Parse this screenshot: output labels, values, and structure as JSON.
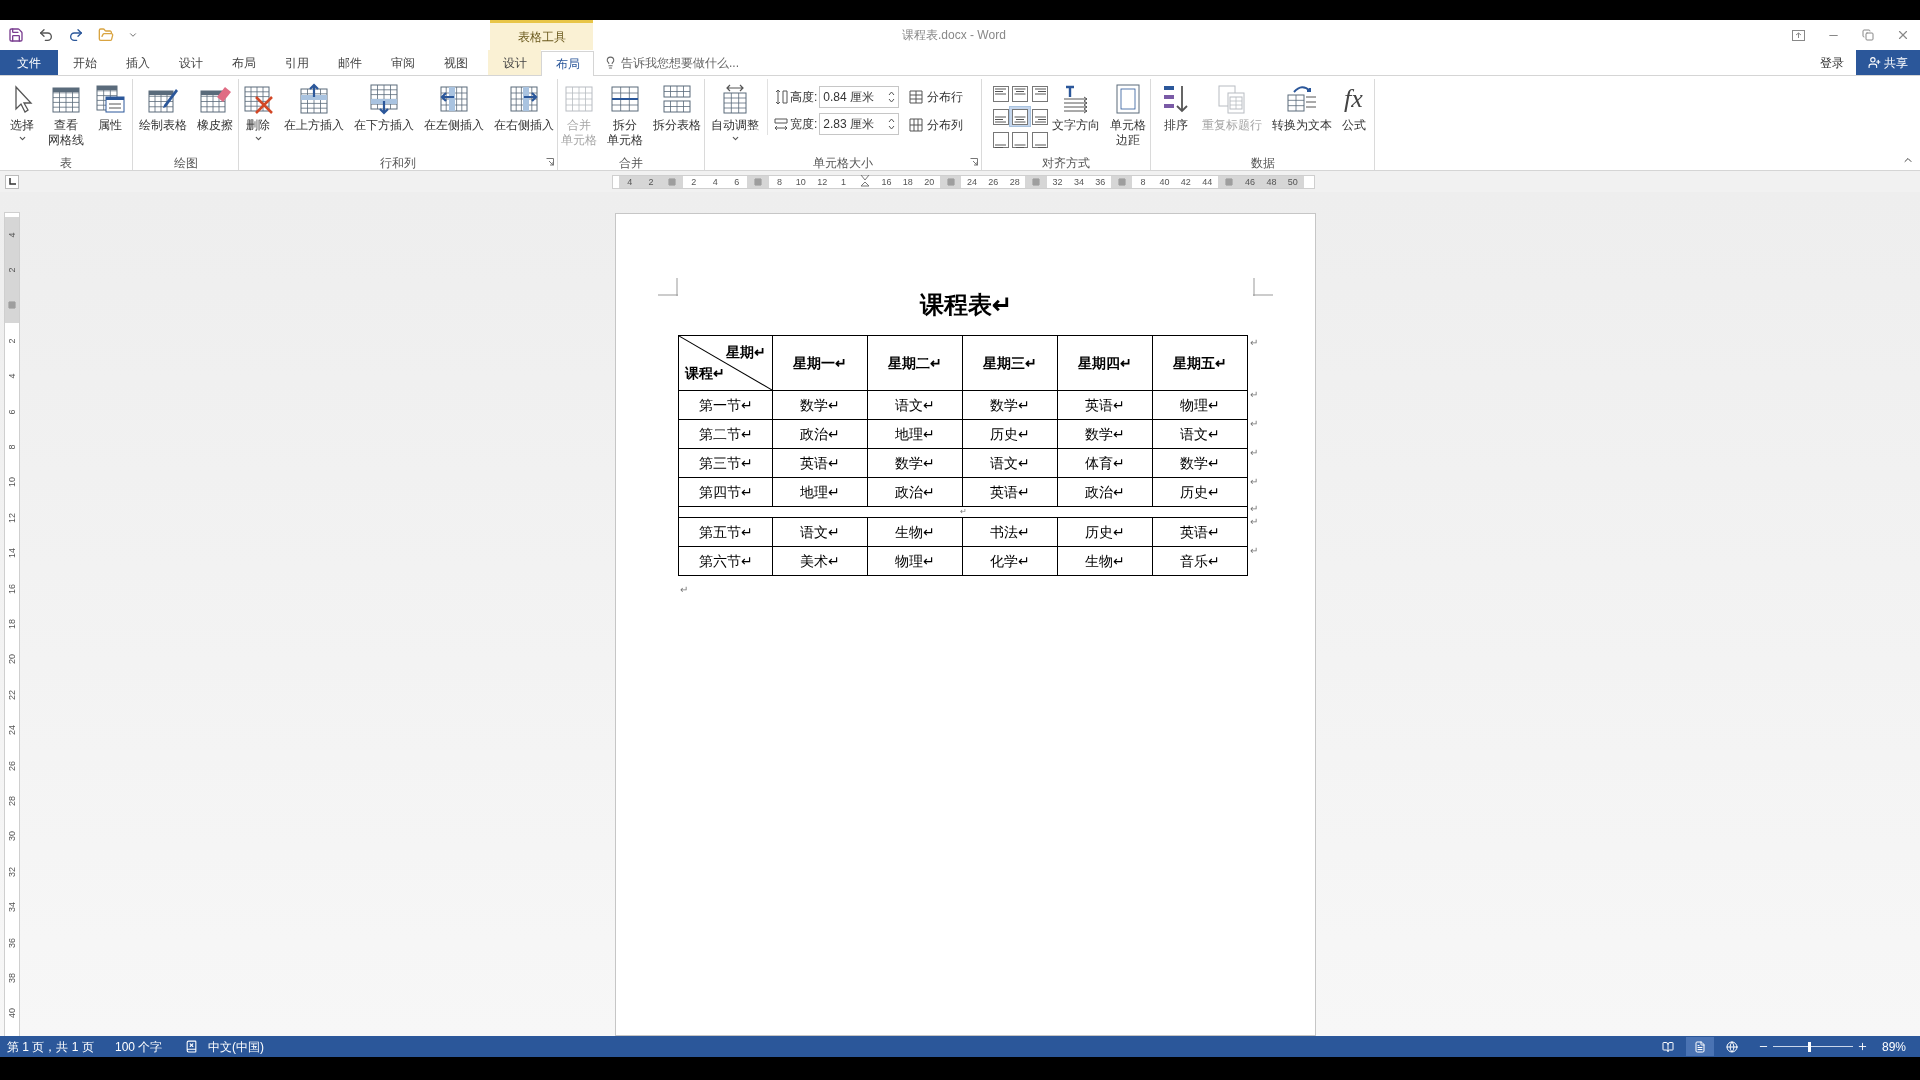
{
  "window": {
    "title": "课程表.docx - Word"
  },
  "context_group": "表格工具",
  "tabs": [
    {
      "label": "文件",
      "kind": "file",
      "selected": false
    },
    {
      "label": "开始",
      "kind": "plain",
      "selected": false
    },
    {
      "label": "插入",
      "kind": "plain",
      "selected": false
    },
    {
      "label": "设计",
      "kind": "plain",
      "selected": false
    },
    {
      "label": "布局",
      "kind": "plain",
      "selected": false
    },
    {
      "label": "引用",
      "kind": "plain",
      "selected": false
    },
    {
      "label": "邮件",
      "kind": "plain",
      "selected": false
    },
    {
      "label": "审阅",
      "kind": "plain",
      "selected": false
    },
    {
      "label": "视图",
      "kind": "plain",
      "selected": false
    },
    {
      "label": "设计",
      "kind": "context",
      "selected": false
    },
    {
      "label": "布局",
      "kind": "context",
      "selected": true
    }
  ],
  "tell_me": {
    "placeholder": "告诉我您想要做什么..."
  },
  "account": {
    "sign_in": "登录",
    "share": "共享"
  },
  "ribbon_groups": [
    {
      "label": "表",
      "kind": "buttons",
      "buttons": [
        {
          "lines": [
            "选择"
          ],
          "kind": "cursor",
          "dropdown": true,
          "disabled": false
        },
        {
          "lines": [
            "查看",
            "网格线"
          ],
          "kind": "grid",
          "disabled": false
        },
        {
          "lines": [
            "属性"
          ],
          "kind": "properties",
          "disabled": false
        }
      ]
    },
    {
      "label": "绘图",
      "kind": "buttons",
      "buttons": [
        {
          "lines": [
            "绘制表格"
          ],
          "kind": "pencil",
          "disabled": false
        },
        {
          "lines": [
            "橡皮擦"
          ],
          "kind": "eraser",
          "disabled": false
        }
      ]
    },
    {
      "label": "行和列",
      "kind": "buttons",
      "launcher": true,
      "buttons": [
        {
          "lines": [
            "删除"
          ],
          "kind": "delete",
          "dropdown": true,
          "disabled": false
        },
        {
          "lines": [
            "在上方插入"
          ],
          "kind": "insert_above",
          "disabled": false
        },
        {
          "lines": [
            "在下方插入"
          ],
          "kind": "insert_below",
          "disabled": false
        },
        {
          "lines": [
            "在左侧插入"
          ],
          "kind": "insert_left",
          "disabled": false
        },
        {
          "lines": [
            "在右侧插入"
          ],
          "kind": "insert_right",
          "disabled": false
        }
      ]
    },
    {
      "label": "合并",
      "kind": "buttons",
      "buttons": [
        {
          "lines": [
            "合并",
            "单元格"
          ],
          "kind": "merge",
          "disabled": true
        },
        {
          "lines": [
            "拆分",
            "单元格"
          ],
          "kind": "split_cells",
          "disabled": false
        },
        {
          "lines": [
            "拆分表格"
          ],
          "kind": "split_table",
          "disabled": false
        }
      ]
    },
    {
      "label": "单元格大小",
      "kind": "cell_size",
      "launcher": true,
      "buttons": [
        {
          "lines": [
            "自动调整"
          ],
          "kind": "autofit",
          "dropdown": true,
          "disabled": false
        }
      ],
      "fields": [
        {
          "label": "高度:",
          "value": "0.84 厘米",
          "kind": "height"
        },
        {
          "label": "宽度:",
          "value": "2.83 厘米",
          "kind": "width"
        }
      ],
      "distribute": [
        {
          "label": "分布行",
          "kind": "rows"
        },
        {
          "label": "分布列",
          "kind": "cols"
        }
      ]
    },
    {
      "label": "对齐方式",
      "kind": "alignment",
      "align": [
        {
          "selected": false
        },
        {
          "selected": false
        },
        {
          "selected": false
        },
        {
          "selected": false
        },
        {
          "selected": true
        },
        {
          "selected": false
        },
        {
          "selected": false
        },
        {
          "selected": false
        },
        {
          "selected": false
        }
      ],
      "buttons": [
        {
          "lines": [
            "文字方向"
          ],
          "kind": "text_direction",
          "disabled": false
        },
        {
          "lines": [
            "单元格",
            "边距"
          ],
          "kind": "margins",
          "disabled": false
        }
      ]
    },
    {
      "label": "数据",
      "kind": "buttons",
      "buttons": [
        {
          "lines": [
            "排序"
          ],
          "kind": "sort",
          "disabled": false
        },
        {
          "lines": [
            "重复标题行"
          ],
          "kind": "repeat",
          "disabled": true
        },
        {
          "lines": [
            "转换为文本"
          ],
          "kind": "convert",
          "disabled": false
        },
        {
          "lines": [
            "公式"
          ],
          "kind": "formula",
          "glyph": "fx",
          "disabled": false
        }
      ]
    }
  ],
  "h_ruler": [
    {
      "kind": "num",
      "label": "4",
      "shaded": true
    },
    {
      "kind": "num",
      "label": "2",
      "shaded": true
    },
    {
      "kind": "marker"
    },
    {
      "kind": "num",
      "label": "2",
      "shaded": false
    },
    {
      "kind": "num",
      "label": "4",
      "shaded": false
    },
    {
      "kind": "num",
      "label": "6",
      "shaded": false
    },
    {
      "kind": "marker"
    },
    {
      "kind": "num",
      "label": "8",
      "shaded": false
    },
    {
      "kind": "num",
      "label": "10",
      "shaded": false
    },
    {
      "kind": "num",
      "label": "12",
      "shaded": false
    },
    {
      "kind": "num",
      "label": "1",
      "shaded": false
    },
    {
      "kind": "indent"
    },
    {
      "kind": "num",
      "label": "16",
      "shaded": false
    },
    {
      "kind": "num",
      "label": "18",
      "shaded": false
    },
    {
      "kind": "num",
      "label": "20",
      "shaded": false
    },
    {
      "kind": "marker"
    },
    {
      "kind": "num",
      "label": "24",
      "shaded": false
    },
    {
      "kind": "num",
      "label": "26",
      "shaded": false
    },
    {
      "kind": "num",
      "label": "28",
      "shaded": false
    },
    {
      "kind": "marker"
    },
    {
      "kind": "num",
      "label": "32",
      "shaded": false
    },
    {
      "kind": "num",
      "label": "34",
      "shaded": false
    },
    {
      "kind": "num",
      "label": "36",
      "shaded": false
    },
    {
      "kind": "marker"
    },
    {
      "kind": "num",
      "label": "8",
      "shaded": false
    },
    {
      "kind": "num",
      "label": "40",
      "shaded": false
    },
    {
      "kind": "num",
      "label": "42",
      "shaded": false
    },
    {
      "kind": "num",
      "label": "44",
      "shaded": false
    },
    {
      "kind": "marker"
    },
    {
      "kind": "num",
      "label": "46",
      "shaded": true
    },
    {
      "kind": "num",
      "label": "48",
      "shaded": true
    },
    {
      "kind": "num",
      "label": "50",
      "shaded": true
    }
  ],
  "v_ruler": [
    {
      "kind": "num",
      "label": "4",
      "shaded": true
    },
    {
      "kind": "num",
      "label": "2",
      "shaded": true
    },
    {
      "kind": "marker"
    },
    {
      "kind": "num",
      "label": "2",
      "shaded": false
    },
    {
      "kind": "num",
      "label": "4",
      "shaded": false
    },
    {
      "kind": "num",
      "label": "6",
      "shaded": false
    },
    {
      "kind": "num",
      "label": "8",
      "shaded": false
    },
    {
      "kind": "num",
      "label": "10",
      "shaded": false
    },
    {
      "kind": "num",
      "label": "12",
      "shaded": false
    },
    {
      "kind": "num",
      "label": "14",
      "shaded": false
    },
    {
      "kind": "num",
      "label": "16",
      "shaded": false
    },
    {
      "kind": "num",
      "label": "18",
      "shaded": false
    },
    {
      "kind": "num",
      "label": "20",
      "shaded": false
    },
    {
      "kind": "num",
      "label": "22",
      "shaded": false
    },
    {
      "kind": "num",
      "label": "24",
      "shaded": false
    },
    {
      "kind": "num",
      "label": "26",
      "shaded": false
    },
    {
      "kind": "num",
      "label": "28",
      "shaded": false
    },
    {
      "kind": "num",
      "label": "30",
      "shaded": false
    },
    {
      "kind": "num",
      "label": "32",
      "shaded": false
    },
    {
      "kind": "num",
      "label": "34",
      "shaded": false
    },
    {
      "kind": "num",
      "label": "36",
      "shaded": false
    },
    {
      "kind": "num",
      "label": "38",
      "shaded": false
    },
    {
      "kind": "num",
      "label": "40",
      "shaded": false
    }
  ],
  "document": {
    "title": "课程表↵",
    "table": {
      "corner": {
        "top": "星期↵",
        "bottom": "课程↵"
      },
      "headers": [
        "星期一↵",
        "星期二↵",
        "星期三↵",
        "星期四↵",
        "星期五↵"
      ],
      "rows": [
        {
          "kind": "data",
          "cells": [
            "第一节↵",
            "数学↵",
            "语文↵",
            "数学↵",
            "英语↵",
            "物理↵"
          ],
          "row_end": "↵"
        },
        {
          "kind": "data",
          "cells": [
            "第二节↵",
            "政治↵",
            "地理↵",
            "历史↵",
            "数学↵",
            "语文↵"
          ],
          "row_end": "↵"
        },
        {
          "kind": "data",
          "cells": [
            "第三节↵",
            "英语↵",
            "数学↵",
            "语文↵",
            "体育↵",
            "数学↵"
          ],
          "row_end": "↵"
        },
        {
          "kind": "data",
          "cells": [
            "第四节↵",
            "地理↵",
            "政治↵",
            "英语↵",
            "政治↵",
            "历史↵"
          ],
          "row_end": "↵"
        },
        {
          "kind": "blank",
          "mark": "↵",
          "row_end": "↵"
        },
        {
          "kind": "data",
          "cells": [
            "第五节↵",
            "语文↵",
            "生物↵",
            "书法↵",
            "历史↵",
            "英语↵"
          ],
          "row_end": "↵"
        },
        {
          "kind": "data",
          "cells": [
            "第六节↵",
            "美术↵",
            "物理↵",
            "化学↵",
            "生物↵",
            "音乐↵"
          ],
          "row_end": "↵"
        }
      ],
      "header_row_end": "↵"
    },
    "after_table": "↵"
  },
  "status_bar": {
    "page": "第 1 页，共 1 页",
    "words": "100 个字",
    "language": "中文(中国)",
    "views": [
      {
        "kind": "read",
        "selected": false
      },
      {
        "kind": "print",
        "selected": true
      },
      {
        "kind": "web",
        "selected": false
      }
    ],
    "zoom": {
      "level": 0.45,
      "reading": "89%"
    }
  }
}
